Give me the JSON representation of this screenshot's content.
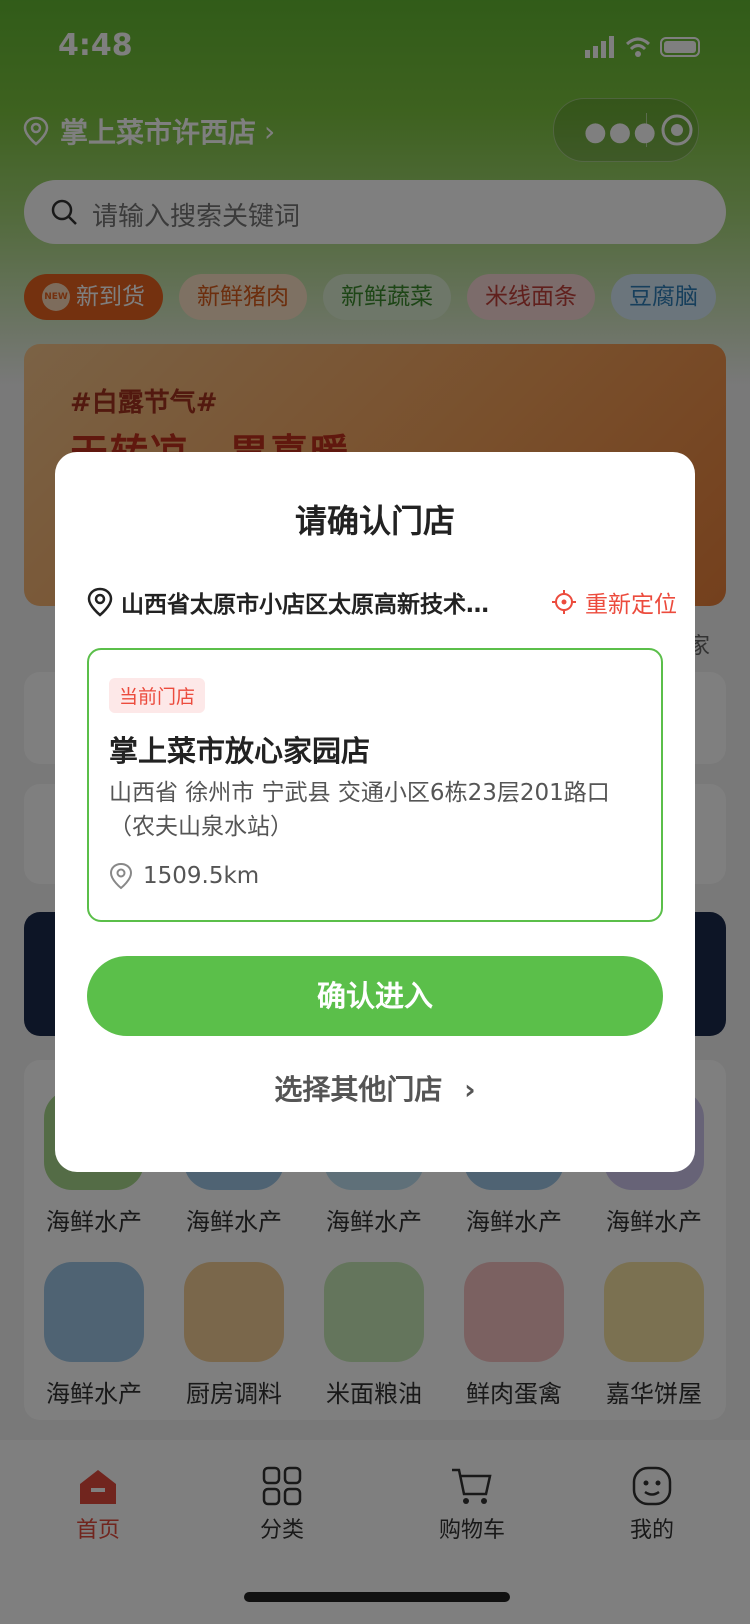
{
  "status": {
    "time": "4:48"
  },
  "header": {
    "store_name": "掌上菜市许西店",
    "chevron": "›"
  },
  "search": {
    "placeholder": "请输入搜索关键词"
  },
  "chips": [
    {
      "label": "新到货",
      "badge": "NEW"
    },
    {
      "label": "新鲜猪肉"
    },
    {
      "label": "新鲜蔬菜"
    },
    {
      "label": "米线面条"
    },
    {
      "label": "豆腐脑"
    }
  ],
  "banner": {
    "tag": "#白露节气#",
    "title": "天转凉，胃喜暖"
  },
  "background_fragments": {
    "right_text": "家"
  },
  "categories": [
    {
      "label": "海鲜水产"
    },
    {
      "label": "海鲜水产"
    },
    {
      "label": "海鲜水产"
    },
    {
      "label": "海鲜水产"
    },
    {
      "label": "海鲜水产"
    },
    {
      "label": "海鲜水产"
    },
    {
      "label": "厨房调料"
    },
    {
      "label": "米面粮油"
    },
    {
      "label": "鲜肉蛋禽"
    },
    {
      "label": "嘉华饼屋"
    }
  ],
  "tabbar": [
    {
      "label": "首页",
      "icon": "home-icon"
    },
    {
      "label": "分类",
      "icon": "grid-icon"
    },
    {
      "label": "购物车",
      "icon": "cart-icon"
    },
    {
      "label": "我的",
      "icon": "face-icon"
    }
  ],
  "modal": {
    "title": "请确认门店",
    "location": "山西省太原市小店区太原高新技术…",
    "relocate_label": "重新定位",
    "store_tag": "当前门店",
    "store_name": "掌上菜市放心家园店",
    "store_address": "山西省 徐州市 宁武县 交通小区6栋23层201路口（农夫山泉水站）",
    "distance": "1509.5km",
    "confirm_label": "确认进入",
    "other_label": "选择其他门店",
    "other_chevron": "›"
  },
  "colors": {
    "brand_green": "#5bbf4a",
    "accent_red": "#ec4b3d"
  }
}
